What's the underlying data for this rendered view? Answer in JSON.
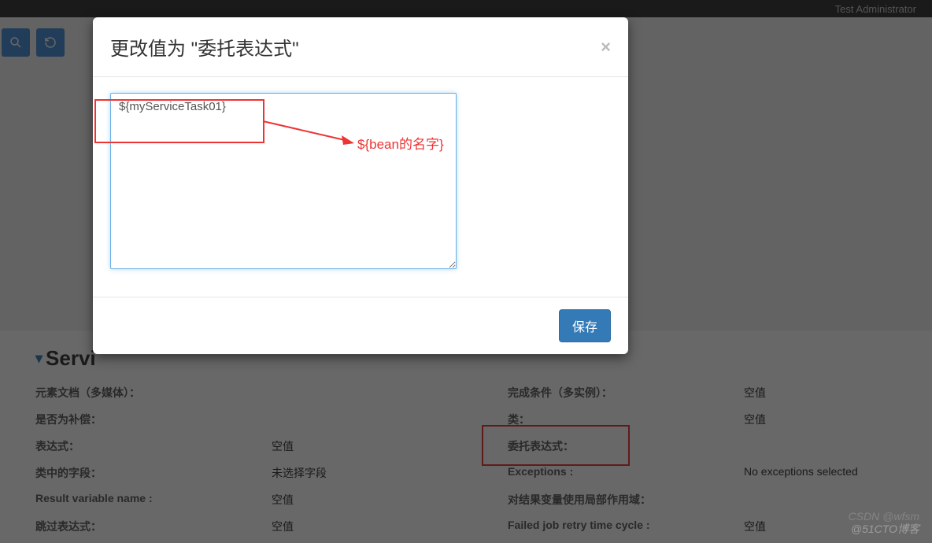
{
  "nav": {
    "user": "Test Administrator"
  },
  "modal": {
    "title": "更改值为 \"委托表达式\"",
    "value": "${myServiceTask01}",
    "save": "保存"
  },
  "annotation": {
    "hint": "${bean的名字}"
  },
  "section": {
    "title": "Servi"
  },
  "props": {
    "left": [
      {
        "label": "元素文档（多媒体）：",
        "value": ""
      },
      {
        "label": "是否为补偿：",
        "value": ""
      },
      {
        "label": "表达式：",
        "value": "空值"
      },
      {
        "label": "类中的字段：",
        "value": "未选择字段"
      },
      {
        "label": "Result variable name :",
        "value": "空值"
      },
      {
        "label": "跳过表达式：",
        "value": "空值"
      }
    ],
    "right": [
      {
        "label": "完成条件（多实例）：",
        "value": "空值"
      },
      {
        "label": "类：",
        "value": "空值"
      },
      {
        "label": "委托表达式：",
        "value": ""
      },
      {
        "label": "Exceptions :",
        "value": "No exceptions selected"
      },
      {
        "label": "对结果变量使用局部作用域：",
        "value": ""
      },
      {
        "label": "Failed job retry time cycle :",
        "value": "空值"
      }
    ]
  },
  "watermark": {
    "a": "@51CTO博客",
    "b": "CSDN @wfsm"
  }
}
